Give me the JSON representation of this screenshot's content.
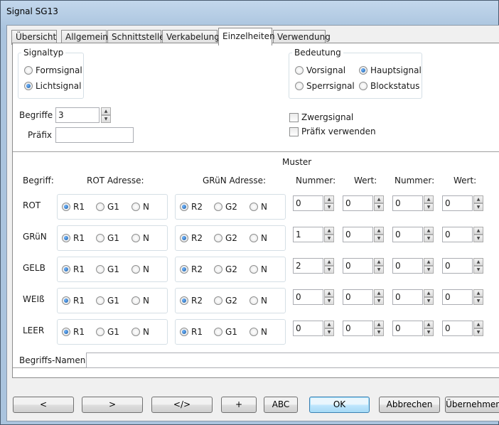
{
  "window": {
    "title": "Signal SG13"
  },
  "tabs": [
    {
      "label": "Übersicht"
    },
    {
      "label": "Allgemein"
    },
    {
      "label": "Schnittstelle"
    },
    {
      "label": "Verkabelung"
    },
    {
      "label": "Einzelheiten"
    },
    {
      "label": "Verwendung"
    }
  ],
  "active_tab": "Einzelheiten",
  "signaltyp": {
    "title": "Signaltyp",
    "options": [
      {
        "label": "Formsignal",
        "selected": false
      },
      {
        "label": "Lichtsignal",
        "selected": true
      }
    ]
  },
  "bedeutung": {
    "title": "Bedeutung",
    "options": [
      {
        "label": "Vorsignal",
        "selected": false
      },
      {
        "label": "Hauptsignal",
        "selected": true
      },
      {
        "label": "Sperrsignal",
        "selected": false
      },
      {
        "label": "Blockstatus",
        "selected": false
      }
    ]
  },
  "begriffe": {
    "label": "Begriffe",
    "value": "3"
  },
  "praefix": {
    "label": "Präfix",
    "value": ""
  },
  "zwergsignal": {
    "label": "Zwergsignal",
    "checked": false
  },
  "praefix_verwenden": {
    "label": "Präfix verwenden",
    "checked": false
  },
  "muster": {
    "title": "Muster",
    "headers": {
      "begriff": "Begriff:",
      "rot": "ROT Adresse:",
      "gruen": "GRüN Adresse:",
      "nummer1": "Nummer:",
      "wert1": "Wert:",
      "nummer2": "Nummer:",
      "wert2": "Wert:"
    },
    "rows": [
      {
        "name": "ROT",
        "rot": [
          {
            "l": "R1",
            "on": true
          },
          {
            "l": "G1",
            "on": false
          },
          {
            "l": "N",
            "on": false
          }
        ],
        "gruen": [
          {
            "l": "R2",
            "on": true
          },
          {
            "l": "G2",
            "on": false
          },
          {
            "l": "N",
            "on": false
          }
        ],
        "vals": [
          "0",
          "0",
          "0",
          "0"
        ]
      },
      {
        "name": "GRüN",
        "rot": [
          {
            "l": "R1",
            "on": true
          },
          {
            "l": "G1",
            "on": false
          },
          {
            "l": "N",
            "on": false
          }
        ],
        "gruen": [
          {
            "l": "R2",
            "on": true
          },
          {
            "l": "G2",
            "on": false
          },
          {
            "l": "N",
            "on": false
          }
        ],
        "vals": [
          "1",
          "0",
          "0",
          "0"
        ]
      },
      {
        "name": "GELB",
        "rot": [
          {
            "l": "R1",
            "on": true
          },
          {
            "l": "G1",
            "on": false
          },
          {
            "l": "N",
            "on": false
          }
        ],
        "gruen": [
          {
            "l": "R2",
            "on": true
          },
          {
            "l": "G2",
            "on": false
          },
          {
            "l": "N",
            "on": false
          }
        ],
        "vals": [
          "2",
          "0",
          "0",
          "0"
        ]
      },
      {
        "name": "WEIß",
        "rot": [
          {
            "l": "R1",
            "on": true
          },
          {
            "l": "G1",
            "on": false
          },
          {
            "l": "N",
            "on": false
          }
        ],
        "gruen": [
          {
            "l": "R2",
            "on": true
          },
          {
            "l": "G2",
            "on": false
          },
          {
            "l": "N",
            "on": false
          }
        ],
        "vals": [
          "0",
          "0",
          "0",
          "0"
        ]
      },
      {
        "name": "LEER",
        "rot": [
          {
            "l": "R1",
            "on": true
          },
          {
            "l": "G1",
            "on": false
          },
          {
            "l": "N",
            "on": false
          }
        ],
        "gruen": [
          {
            "l": "R1",
            "on": true
          },
          {
            "l": "G1",
            "on": false
          },
          {
            "l": "N",
            "on": false
          }
        ],
        "vals": [
          "0",
          "0",
          "0",
          "0"
        ]
      }
    ]
  },
  "begriffs_namen": {
    "label": "Begriffs-Namen",
    "value": ""
  },
  "footer": {
    "buttons": [
      "<",
      ">",
      "</>",
      "+",
      "ABC",
      "OK",
      "Abbrechen",
      "Übernehmen"
    ]
  }
}
